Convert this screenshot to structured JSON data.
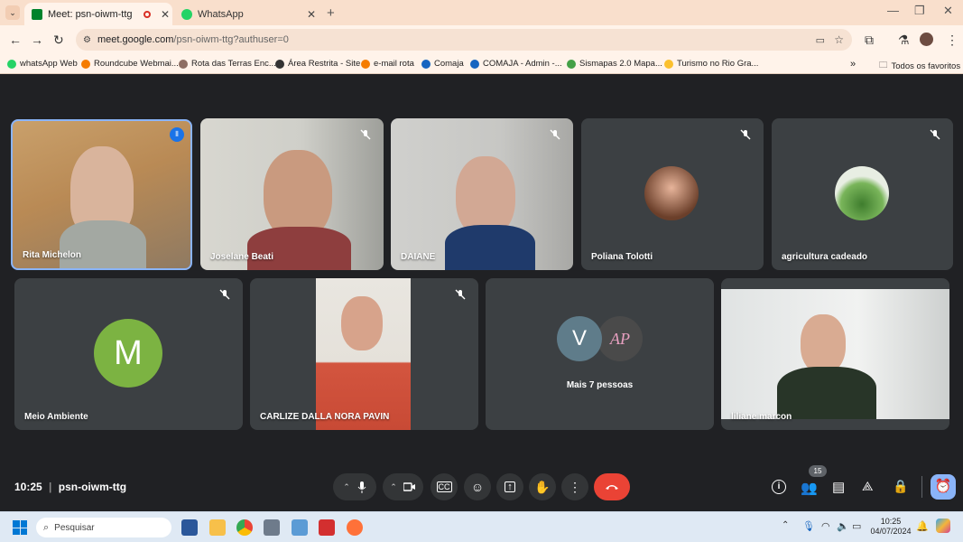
{
  "browser": {
    "tabs": [
      {
        "label": "Meet: psn-oiwm-ttg"
      },
      {
        "label": "WhatsApp"
      }
    ],
    "url_host": "meet.google.com",
    "url_path": "/psn-oiwm-ttg?authuser=0",
    "bookmarks": [
      "whatsApp Web",
      "Roundcube Webmai...",
      "Rota das Terras Enc...",
      "Área Restrita - Site",
      "e-mail rota",
      "Comaja",
      "COMAJA - Admin -...",
      "Sismapas 2.0 Mapa...",
      "Turismo no Rio Gra..."
    ],
    "all_bookmarks": "Todos os favoritos"
  },
  "participants": [
    {
      "name": "Rita Michelon"
    },
    {
      "name": "Joselane Beati"
    },
    {
      "name": "DAIANE"
    },
    {
      "name": "Poliana Tolotti"
    },
    {
      "name": "agricultura cadeado"
    },
    {
      "name": "Meio Ambiente",
      "initial": "M"
    },
    {
      "name": "CARLIZE DALLA NORA PAVIN"
    },
    {
      "name": "Mais 7 pessoas",
      "initial": "V",
      "logo_text": "AP"
    },
    {
      "name": "liliane marcon"
    }
  ],
  "meeting": {
    "time": "10:25",
    "code": "psn-oiwm-ttg",
    "people_count": "15"
  },
  "taskbar": {
    "search_placeholder": "Pesquisar",
    "time": "10:25",
    "date": "04/07/2024"
  },
  "colors": {
    "accent": "#8ab4f8",
    "end_call": "#ea4335",
    "meio_avatar": "#7cb342",
    "v_avatar": "#5f7c8a"
  }
}
